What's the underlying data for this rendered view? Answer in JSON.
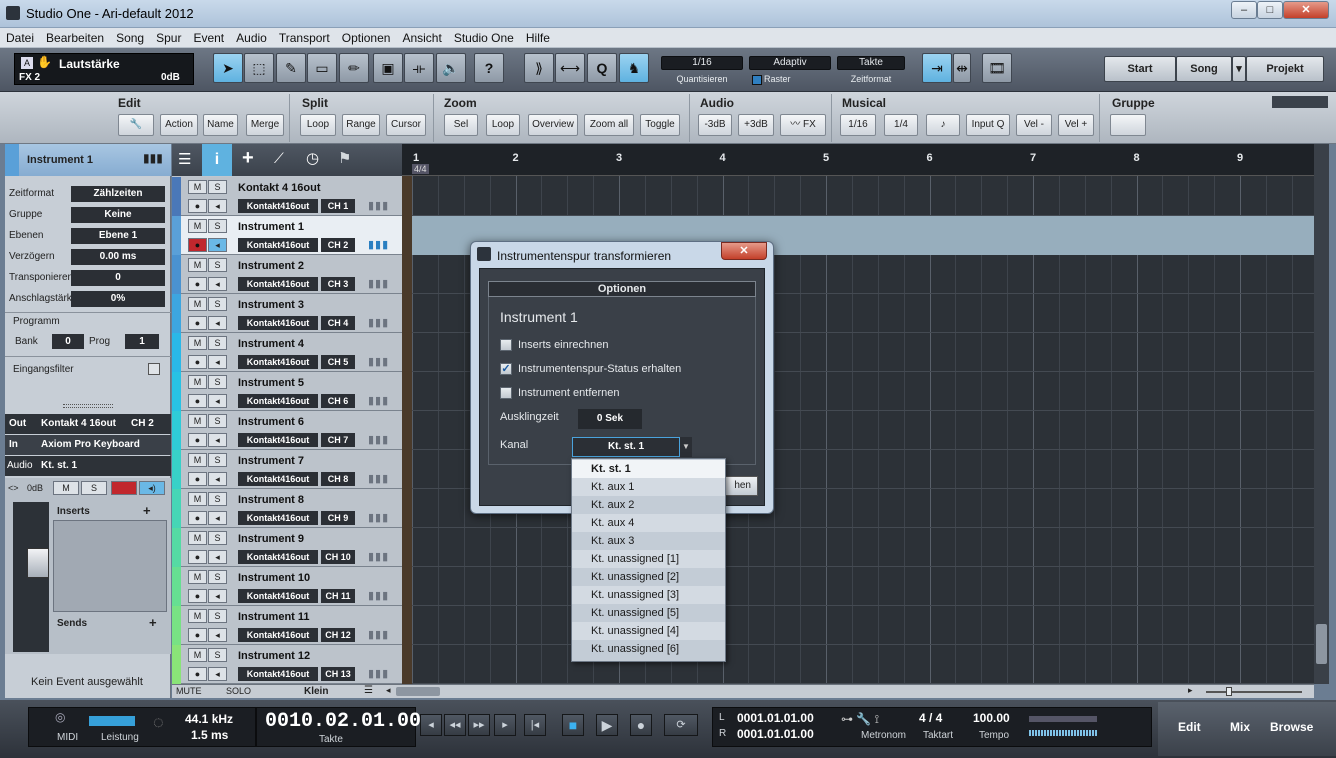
{
  "window": {
    "title": "Studio One - Ari-default 2012",
    "min": "–",
    "max": "□",
    "close": "✕"
  },
  "menu": [
    "Datei",
    "Bearbeiten",
    "Song",
    "Spur",
    "Event",
    "Audio",
    "Transport",
    "Optionen",
    "Ansicht",
    "Studio One",
    "Hilfe"
  ],
  "toolbar": {
    "track_param_badge": "A",
    "track_param": "Lautstärke",
    "track_fx": "FX 2",
    "track_db": "0dB",
    "quantize_value": "1/16",
    "quantize_label": "Quantisieren",
    "snap_value": "Adaptiv",
    "snap_label": "Raster",
    "timeformat_value": "Takte",
    "timeformat_label": "Zeitformat",
    "start": "Start",
    "song": "Song",
    "projekt": "Projekt",
    "help": "?",
    "quant": "Q"
  },
  "macro": {
    "edit": {
      "title": "Edit",
      "buttons": [
        "Action",
        "Name",
        "Merge"
      ]
    },
    "split": {
      "title": "Split",
      "buttons": [
        "Loop",
        "Range",
        "Cursor"
      ]
    },
    "zoom": {
      "title": "Zoom",
      "buttons": [
        "Sel",
        "Loop",
        "Overview",
        "Zoom all",
        "Toggle"
      ]
    },
    "audio": {
      "title": "Audio",
      "buttons": [
        "-3dB",
        "+3dB",
        "FX"
      ]
    },
    "musical": {
      "title": "Musical",
      "buttons": [
        "1/16",
        "1/4",
        "Input Q",
        "Vel -",
        "Vel +"
      ]
    },
    "gruppe": {
      "title": "Gruppe"
    }
  },
  "inspector": {
    "track_name": "Instrument 1",
    "rows": [
      {
        "label": "Zeitformat",
        "value": "Zählzeiten"
      },
      {
        "label": "Gruppe",
        "value": "Keine"
      },
      {
        "label": "Ebenen",
        "value": "Ebene 1"
      },
      {
        "label": "Verzögern",
        "value": "0.00 ms"
      },
      {
        "label": "Transponieren",
        "value": "0"
      },
      {
        "label": "Anschlagstärke",
        "value": "0%"
      }
    ],
    "programm": "Programm",
    "bank_label": "Bank",
    "bank": "0",
    "prog_label": "Prog",
    "prog": "1",
    "eingangsfilter": "Eingangsfilter",
    "out_label": "Out",
    "out_value": "Kontakt 4 16out",
    "out_ch": "CH 2",
    "in_label": "In",
    "in_value": "Axiom Pro Keyboard",
    "audio_label": "Audio",
    "audio_value": "Kt. st. 1",
    "vol_db": "0dB",
    "inserts": "Inserts",
    "sends": "Sends",
    "no_event": "Kein Event ausgewählt",
    "mute_btn": "M",
    "solo_btn": "S"
  },
  "tracks": [
    {
      "name": "Kontakt 4 16out",
      "out": "Kontakt416out",
      "ch": "CH 1",
      "m": "M",
      "s": "S",
      "color": "#4a78b8"
    },
    {
      "name": "Instrument 1",
      "out": "Kontakt416out",
      "ch": "CH 2",
      "m": "M",
      "s": "S",
      "color": "#5aa0d8"
    },
    {
      "name": "Instrument 2",
      "out": "Kontakt416out",
      "ch": "CH 3",
      "m": "M",
      "s": "S",
      "color": "#4a92d0"
    },
    {
      "name": "Instrument 3",
      "out": "Kontakt416out",
      "ch": "CH 4",
      "m": "M",
      "s": "S",
      "color": "#3da6e0"
    },
    {
      "name": "Instrument 4",
      "out": "Kontakt416out",
      "ch": "CH 5",
      "m": "M",
      "s": "S",
      "color": "#2ab8e8"
    },
    {
      "name": "Instrument 5",
      "out": "Kontakt416out",
      "ch": "CH 6",
      "m": "M",
      "s": "S",
      "color": "#28c2e4"
    },
    {
      "name": "Instrument 6",
      "out": "Kontakt416out",
      "ch": "CH 7",
      "m": "M",
      "s": "S",
      "color": "#2fcbd8"
    },
    {
      "name": "Instrument 7",
      "out": "Kontakt416out",
      "ch": "CH 8",
      "m": "M",
      "s": "S",
      "color": "#38d1c8"
    },
    {
      "name": "Instrument 8",
      "out": "Kontakt416out",
      "ch": "CH 9",
      "m": "M",
      "s": "S",
      "color": "#46d6b6"
    },
    {
      "name": "Instrument 9",
      "out": "Kontakt416out",
      "ch": "CH 10",
      "m": "M",
      "s": "S",
      "color": "#55dba4"
    },
    {
      "name": "Instrument 10",
      "out": "Kontakt416out",
      "ch": "CH 11",
      "m": "M",
      "s": "S",
      "color": "#66df92"
    },
    {
      "name": "Instrument 11",
      "out": "Kontakt416out",
      "ch": "CH 12",
      "m": "M",
      "s": "S",
      "color": "#78e284"
    },
    {
      "name": "Instrument 12",
      "out": "Kontakt416out",
      "ch": "CH 13",
      "m": "M",
      "s": "S",
      "color": "#8ae478"
    }
  ],
  "tracklist_footer": {
    "mute": "MUTE",
    "solo": "SOLO",
    "size": "Klein"
  },
  "ruler": {
    "signature": "4/4",
    "bars": [
      "1",
      "2",
      "3",
      "4",
      "5",
      "6",
      "7",
      "8",
      "9"
    ]
  },
  "transport": {
    "midi": "MIDI",
    "leistung": "Leistung",
    "rate": "44.1 kHz",
    "latency": "1.5 ms",
    "position": "0010.02.01.00",
    "position_label": "Takte",
    "loop_l": "0001.01.01.00",
    "loop_r": "0001.01.01.00",
    "l": "L",
    "r": "R",
    "metronom": "Metronom",
    "taktart_value": "4 / 4",
    "taktart": "Taktart",
    "tempo_value": "100.00",
    "tempo": "Tempo",
    "edit": "Edit",
    "mix": "Mix",
    "browse": "Browse"
  },
  "dialog": {
    "title": "Instrumentenspur transformieren",
    "section": "Optionen",
    "track": "Instrument 1",
    "options": [
      {
        "label": "Inserts einrechnen",
        "checked": false
      },
      {
        "label": "Instrumentenspur-Status erhalten",
        "checked": true
      },
      {
        "label": "Instrument entfernen",
        "checked": false
      }
    ],
    "ausklingzeit_label": "Ausklingzeit",
    "ausklingzeit_value": "0 Sek",
    "kanal_label": "Kanal",
    "kanal_value": "Kt. st. 1",
    "button_fragment": "hen"
  },
  "dropdown": [
    "Kt. st. 1",
    "Kt. aux 1",
    "Kt. aux 2",
    "Kt. aux 4",
    "Kt. aux 3",
    "Kt.  unassigned [1]",
    "Kt.  unassigned [2]",
    "Kt.  unassigned [3]",
    "Kt.  unassigned [5]",
    "Kt.  unassigned [4]",
    "Kt.  unassigned [6]"
  ]
}
